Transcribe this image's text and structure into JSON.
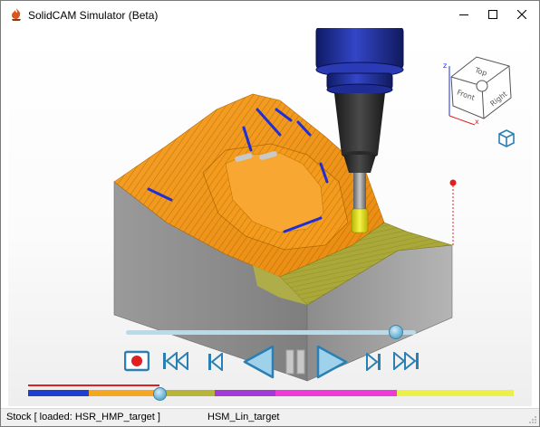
{
  "window": {
    "title": "SolidCAM Simulator (Beta)",
    "icon": "solidcam-flame-icon",
    "controls": {
      "minimize": "minimize-icon",
      "maximize": "maximize-icon",
      "close": "close-icon"
    }
  },
  "view_cube": {
    "faces": {
      "top": "Top",
      "front": "Front",
      "right": "Right"
    },
    "axes": {
      "z": "z",
      "x": "x"
    }
  },
  "playback": {
    "position_slider_fraction": 0.93,
    "buttons": {
      "record": "record-icon",
      "skip_to_start": "skip-to-start-icon",
      "step_back": "step-back-icon",
      "play_reverse": "play-reverse-icon",
      "pause": "pause-icon",
      "play": "play-icon",
      "step_forward": "step-forward-icon",
      "skip_to_end": "skip-to-end-icon"
    }
  },
  "operations_bar": {
    "progress_fraction": 0.27,
    "segments": [
      {
        "color": "#1e3fd0",
        "fraction": 0.125
      },
      {
        "color": "#f5a623",
        "fraction": 0.15
      },
      {
        "color": "#b8b33a",
        "fraction": 0.11
      },
      {
        "color": "#a33ad6",
        "fraction": 0.125
      },
      {
        "color": "#ee3ad8",
        "fraction": 0.125
      },
      {
        "color": "#ee3ad8",
        "fraction": 0.125
      },
      {
        "color": "#eef04a",
        "fraction": 0.125
      },
      {
        "color": "#eef04a",
        "fraction": 0.115
      }
    ]
  },
  "statusbar": {
    "stock_text": "Stock [ loaded:  HSR_HMP_target ]",
    "operation_text": "HSM_Lin_target"
  },
  "colors": {
    "stock_orange": "#f29a1c",
    "toolpath_blue": "#1f2fd6",
    "finish_olive": "#a9a83a",
    "stock_gray": "#8f8f8f",
    "spindle_navy": "#1d2a8a",
    "tool_yellow": "#e6e21e",
    "control_blue": "#2a7fb3"
  }
}
